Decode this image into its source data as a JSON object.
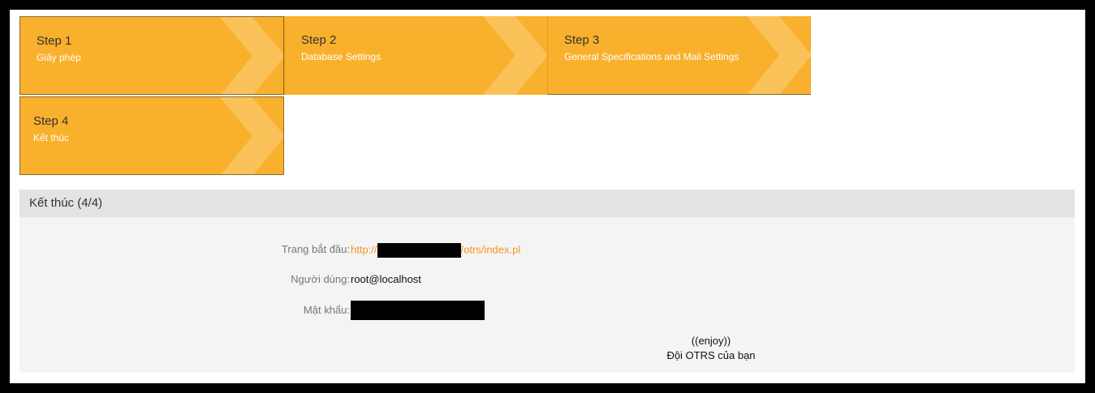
{
  "steps": [
    {
      "title": "Step 1",
      "subtitle": "Giấy phép"
    },
    {
      "title": "Step 2",
      "subtitle": "Database Settings"
    },
    {
      "title": "Step 3",
      "subtitle": "General Specifications and Mail Settings"
    },
    {
      "title": "Step 4",
      "subtitle": "Kết thúc"
    }
  ],
  "panel": {
    "title": "Kết thúc (4/4)",
    "fields": {
      "start_page": {
        "label": "Trang bắt đầu:",
        "prefix": "http://",
        "suffix": "/otrs/index.pl"
      },
      "user": {
        "label": "Người dùng:",
        "value": "root@localhost"
      },
      "password": {
        "label": "Mật khẩu:"
      }
    },
    "footer": {
      "line1": "((enjoy))",
      "line2": "Đội OTRS của bạn"
    }
  },
  "colors": {
    "step_bg": "#f9b02c",
    "link": "#f7941d"
  }
}
